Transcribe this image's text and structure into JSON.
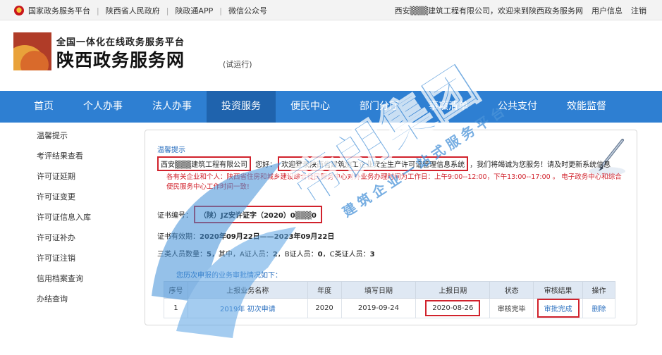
{
  "topbar": {
    "links": [
      "国家政务服务平台",
      "陕西省人民政府",
      "陕政通APP",
      "微信公众号"
    ],
    "welcome": "西安▒▒▒建筑工程有限公司，欢迎来到陕西政务服务网",
    "user_info": "用户信息",
    "logout": "注销"
  },
  "header": {
    "slogan": "全国一体化在线政务服务平台",
    "site_name": "陕西政务服务网",
    "trial": "(试运行)"
  },
  "nav": {
    "items": [
      "首页",
      "个人办事",
      "法人办事",
      "投资服务",
      "便民中心",
      "部门分厅",
      "事项清单",
      "公共支付",
      "效能监督"
    ],
    "active_index": 3
  },
  "sidebar": {
    "items": [
      "温馨提示",
      "考评结果查看",
      "许可证延期",
      "许可证变更",
      "许可证信息入库",
      "许可证补办",
      "许可证注销",
      "信用档案查询",
      "办结查询"
    ]
  },
  "panel": {
    "tip_title": "温馨提示",
    "company": "西安▒▒▒建筑工程有限公司",
    "hello": "您好：",
    "system_text": "欢迎登录陕西省建筑施工企业安全生产许可证管理信息系统",
    "serve_text": "，我们将竭诚为您服务！请及时更新系统信息",
    "notice": "各有关企业和个人：陕西省住房和城乡建设综合便民服务中心对外业务办理时间为工作日：上午9:00--12:00，下午13:00--17:00 。 电子政务中心和综合便民服务中心工作时间一致!",
    "cert_label": "证书编号：",
    "cert_no": "（陕）JZ安许证字（2020）0▒▒▒0",
    "validity_label": "证书有效期：",
    "validity_value": "2020年09月22日——2023年09月22日",
    "staff_prefix": "三类人员数量：",
    "staff_total": "5",
    "staff_a_label": "，其中，A证人员：",
    "staff_a": "2",
    "staff_b_label": "，B证人员：",
    "staff_b": "0",
    "staff_c_label": "，C类证人员：",
    "staff_c": "3",
    "history_title": "您历次申报的业务审批情况如下："
  },
  "table": {
    "headers": [
      "序号",
      "上报业务名称",
      "年度",
      "填写日期",
      "上报日期",
      "状态",
      "审核结果",
      "操作"
    ],
    "rows": [
      [
        "1",
        "2019年 初次申请",
        "2020",
        "2019-09-24",
        "2020-08-26",
        "审核完毕",
        "审批完成",
        "删除"
      ]
    ]
  },
  "watermark": {
    "text_big": "帝朗集团",
    "text_small": "建筑企业一站式服务平台"
  },
  "colors": {
    "nav_bg": "#2e7fd2",
    "nav_active": "#1f63ad",
    "link": "#2a6fbf",
    "highlight": "#d1222c"
  }
}
